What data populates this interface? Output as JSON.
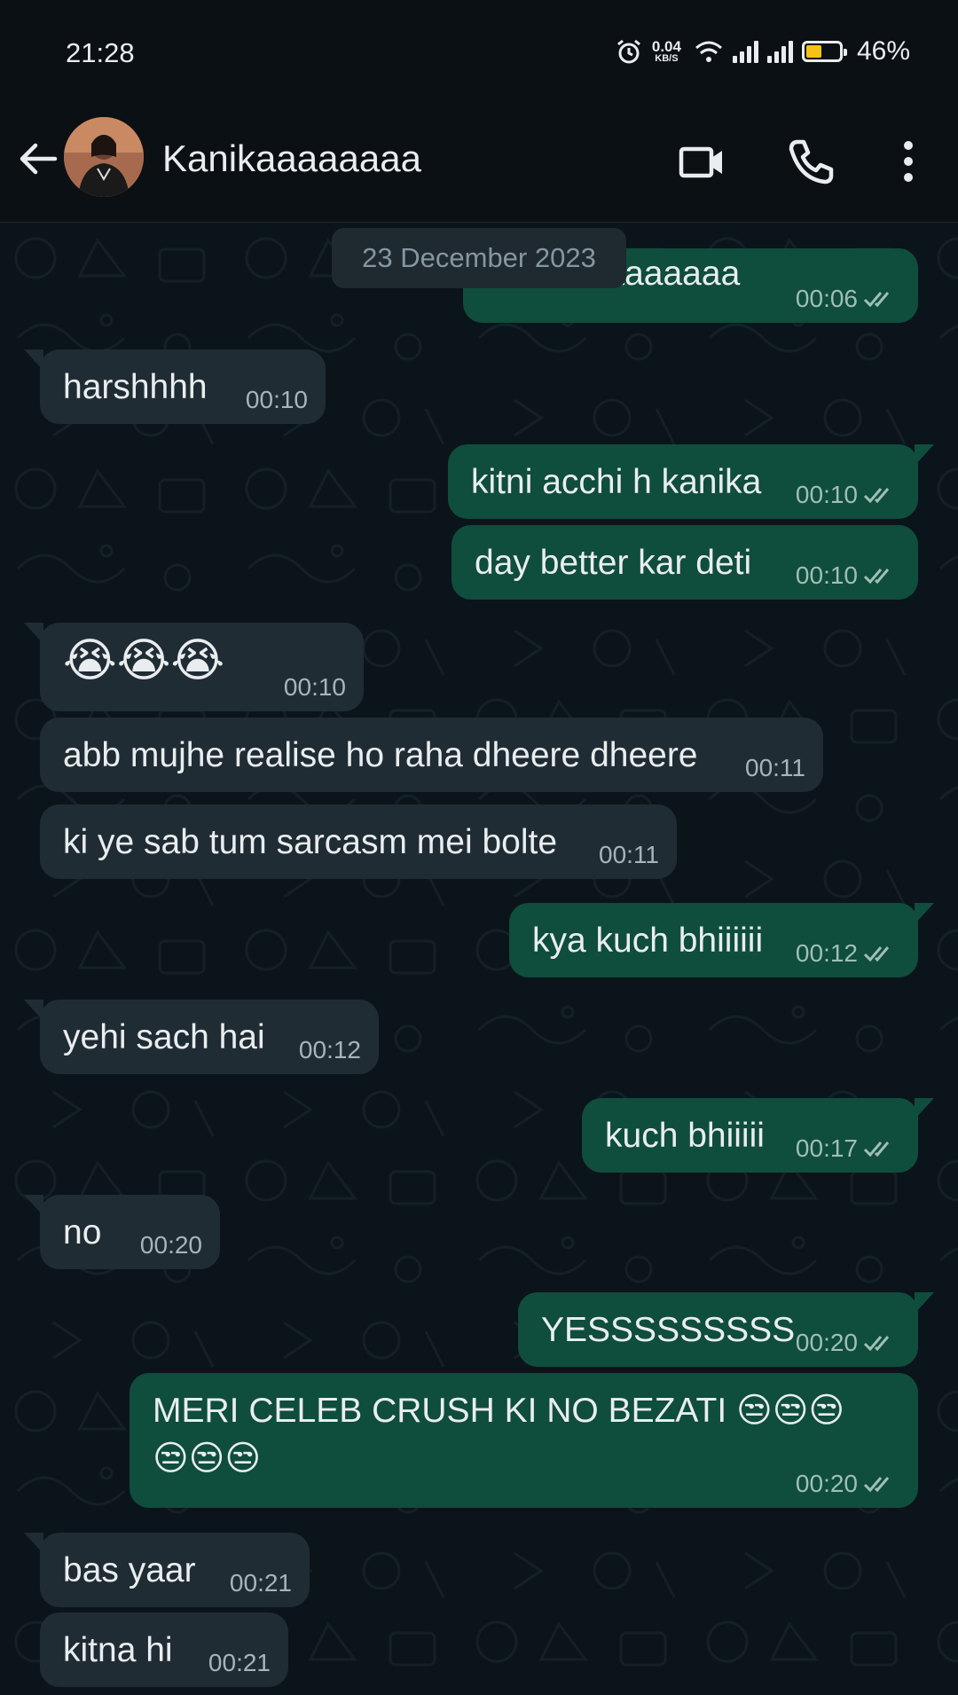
{
  "status_bar": {
    "time": "21:28",
    "net_speed": "0.04",
    "net_unit": "KB/S",
    "battery": "46%",
    "battery_level": 0.46
  },
  "header": {
    "contact_name": "Kanikaaaaaaaa"
  },
  "chat": {
    "date_chip": "23 December 2023",
    "messages": [
      {
        "dir": "out",
        "text": "kanikaaaaaaaaa",
        "time": "00:06"
      },
      {
        "dir": "in",
        "text": "harshhhh",
        "time": "00:10"
      },
      {
        "dir": "out",
        "text": "kitni acchi h kanika",
        "time": "00:10"
      },
      {
        "dir": "out",
        "text": "day better kar deti",
        "time": "00:10"
      },
      {
        "dir": "in",
        "text": "😭😭😭",
        "time": "00:10"
      },
      {
        "dir": "in",
        "text": "abb mujhe realise ho raha dheere dheere",
        "time": "00:11"
      },
      {
        "dir": "in",
        "text": "ki ye sab tum sarcasm mei bolte",
        "time": "00:11"
      },
      {
        "dir": "out",
        "text": "kya kuch bhiiiiii",
        "time": "00:12"
      },
      {
        "dir": "in",
        "text": "yehi sach hai",
        "time": "00:12"
      },
      {
        "dir": "out",
        "text": "kuch bhiiiii",
        "time": "00:17"
      },
      {
        "dir": "in",
        "text": "no",
        "time": "00:20"
      },
      {
        "dir": "out",
        "text": "YESSSSSSSSS",
        "time": "00:20"
      },
      {
        "dir": "out",
        "text": "MERI CELEB CRUSH KI NO BEZATI 😒😒😒",
        "text2": "😒😒😒",
        "time": "00:20"
      },
      {
        "dir": "in",
        "text": "bas yaar",
        "time": "00:21"
      },
      {
        "dir": "in",
        "text": "kitna hi",
        "time": "00:21"
      }
    ]
  },
  "colors": {
    "background": "#0b141a",
    "incoming_bubble": "#202c33",
    "outgoing_bubble": "#0f4d3d",
    "read_tick": "#9fbfb5",
    "battery_fill": "#f5c318"
  }
}
